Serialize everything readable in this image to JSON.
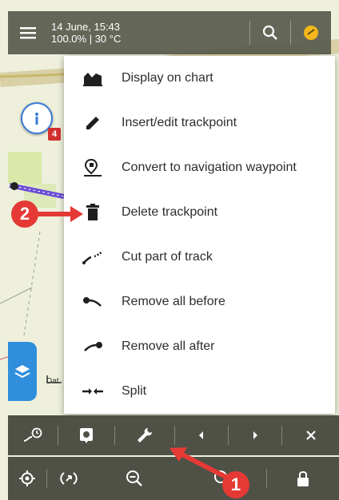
{
  "status": {
    "datetime": "14 June, 15:43",
    "battery_temp": "100.0% | 30 °C"
  },
  "map": {
    "info_badge": "4",
    "scale_label": "Dat"
  },
  "menu": {
    "items": [
      {
        "label": "Display on chart",
        "icon": "chart-icon"
      },
      {
        "label": "Insert/edit trackpoint",
        "icon": "pencil-icon"
      },
      {
        "label": "Convert to navigation waypoint",
        "icon": "waypoint-icon"
      },
      {
        "label": "Delete trackpoint",
        "icon": "trash-icon"
      },
      {
        "label": "Cut part of track",
        "icon": "cut-track-icon"
      },
      {
        "label": "Remove all before",
        "icon": "remove-before-icon"
      },
      {
        "label": "Remove all after",
        "icon": "remove-after-icon"
      },
      {
        "label": "Split",
        "icon": "split-icon"
      }
    ]
  },
  "callouts": {
    "one": "1",
    "two": "2"
  },
  "colors": {
    "accent": "#2f8fdc",
    "callout": "#e53935",
    "bar": "#4f5147"
  }
}
